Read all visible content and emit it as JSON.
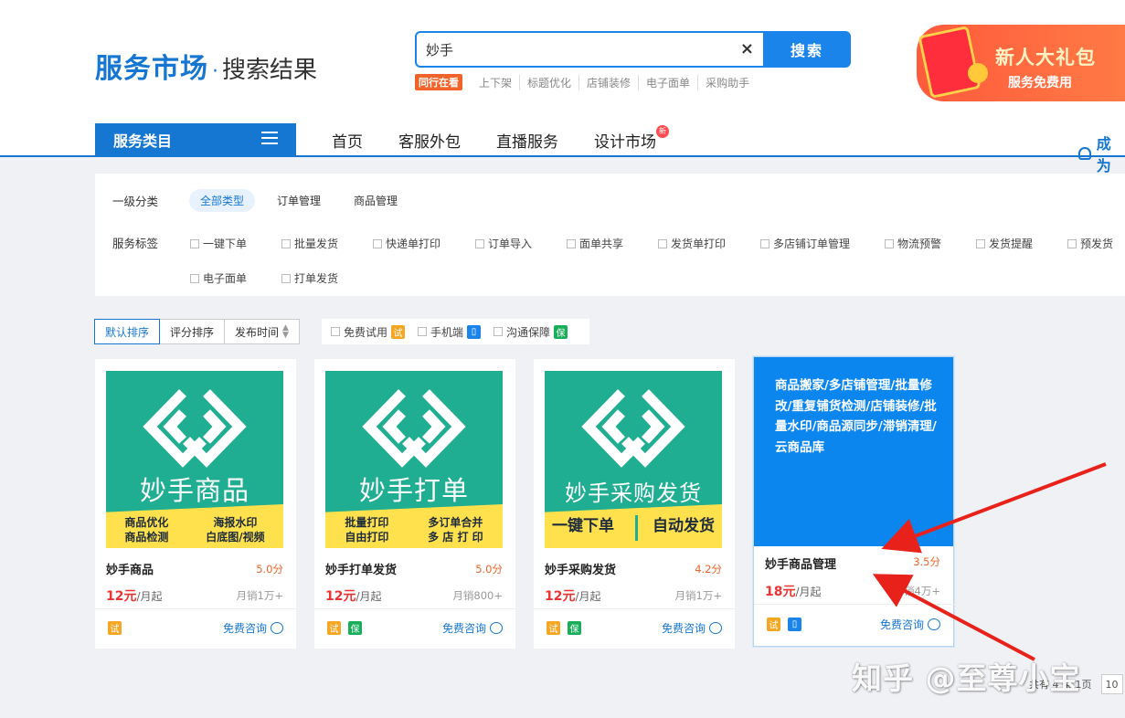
{
  "header": {
    "brand": "服务市场",
    "dot": "·",
    "subtitle": "搜索结果",
    "search": {
      "value": "妙手",
      "clear_icon": "×",
      "button": "搜索"
    },
    "hotwords": {
      "badge": "同行在看",
      "items": [
        "上下架",
        "标题优化",
        "店铺装修",
        "电子面单",
        "采购助手"
      ]
    },
    "promo": {
      "title": "新人大礼包",
      "subtitle": "服务免费用"
    }
  },
  "nav": {
    "category": "服务类目",
    "links": [
      "首页",
      "客服外包",
      "直播服务",
      "设计市场"
    ],
    "new_badge": "新",
    "join": "成为"
  },
  "filters": {
    "level1_label": "一级分类",
    "level1_options": [
      "全部类型",
      "订单管理",
      "商品管理"
    ],
    "tags_label": "服务标签",
    "tags_row1": [
      "一键下单",
      "批量发货",
      "快递单打印",
      "订单导入",
      "面单共享",
      "发货单打印",
      "多店铺订单管理",
      "物流预警",
      "发货提醒",
      "预发货"
    ],
    "tags_row2": [
      "电子面单",
      "打单发货"
    ]
  },
  "sort": {
    "options": [
      "默认排序",
      "评分排序",
      "发布时间"
    ],
    "checks": [
      {
        "label": "免费试用",
        "tag": "试"
      },
      {
        "label": "手机端",
        "tag": ""
      },
      {
        "label": "沟通保障",
        "tag": "保"
      }
    ]
  },
  "cards": [
    {
      "img_name": "妙手商品",
      "band": [
        "商品优化",
        "海报水印",
        "商品检测",
        "白底图/视频"
      ],
      "title": "妙手商品",
      "score": "5.0分",
      "price": "12元",
      "unit": "/月起",
      "sales": "月销1万+",
      "tags": [
        "试"
      ],
      "consult": "免费咨询"
    },
    {
      "img_name": "妙手打单",
      "band": [
        "批量打印",
        "多订单合并",
        "自由打印",
        "多 店 打 印"
      ],
      "title": "妙手打单发货",
      "score": "5.0分",
      "price": "12元",
      "unit": "/月起",
      "sales": "月销800+",
      "tags": [
        "试",
        "保"
      ],
      "consult": "免费咨询"
    },
    {
      "img_name": "妙手采购发货",
      "band": [
        "一键下单",
        "自动发货"
      ],
      "title": "妙手采购发货",
      "score": "4.2分",
      "price": "12元",
      "unit": "/月起",
      "sales": "月销1万+",
      "tags": [
        "试",
        "保"
      ],
      "consult": "免费咨询"
    },
    {
      "img_text": "商品搬家/多店铺管理/批量修改/重复铺货检测/店铺装修/批量水印/商品源同步/滞销清理/云商品库",
      "title": "妙手商品管理",
      "score": "3.5分",
      "price": "18元",
      "unit": "/月起",
      "sales": "月销4万+",
      "tags": [
        "试"
      ],
      "consult": "免费咨询"
    }
  ],
  "watermark": "知乎 @至尊小宝",
  "pager": {
    "text": "共有 4 条 1页",
    "box": "10"
  },
  "colors": {
    "brand_blue": "#1677d2",
    "search_blue": "#1b84ea",
    "teal": "#1fae91",
    "yellow": "#ffe14d",
    "arrow_red": "#e8221b"
  }
}
